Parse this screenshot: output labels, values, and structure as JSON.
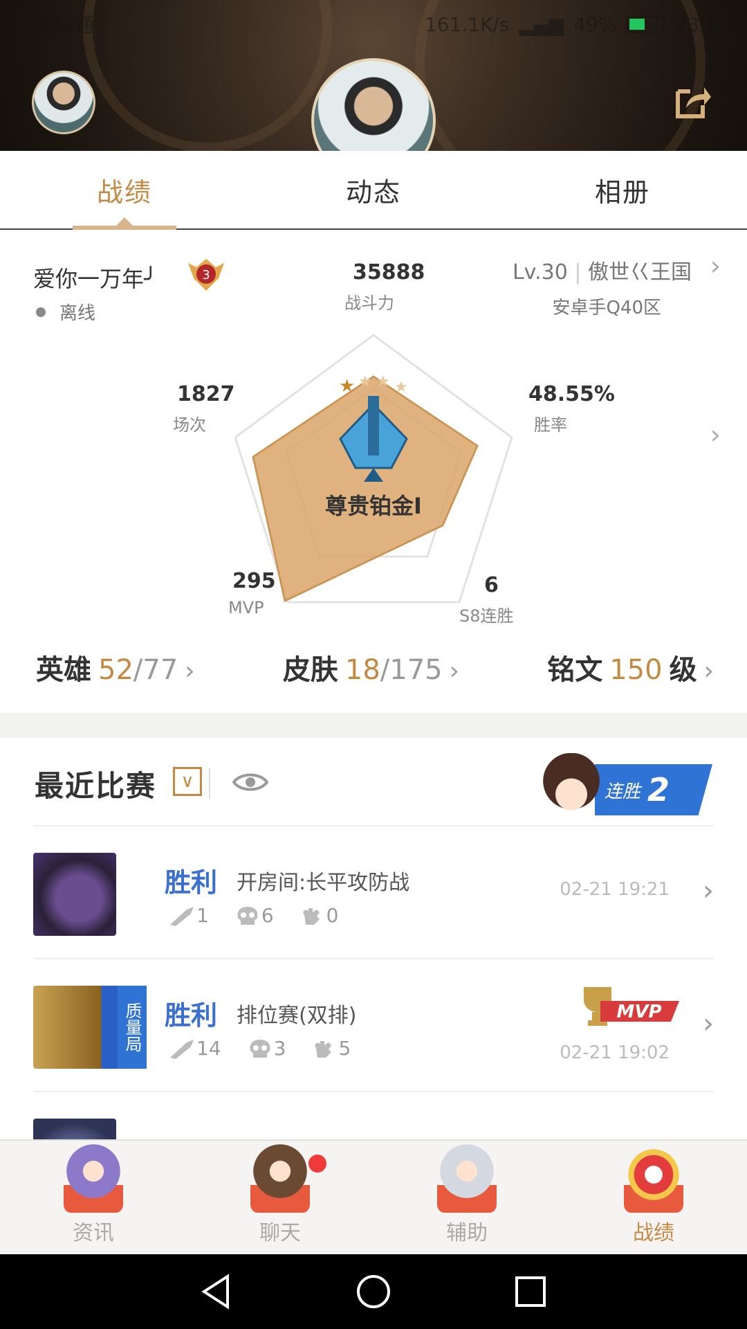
{
  "status_bar": {
    "carrier": "中国联通",
    "speed": "161.1K/s",
    "battery": "49%",
    "time": "23:51"
  },
  "tabs": [
    {
      "label": "战绩",
      "active": true
    },
    {
      "label": "动态",
      "active": false
    },
    {
      "label": "相册",
      "active": false
    }
  ],
  "profile": {
    "name": "爱你一万年╯",
    "rank_badge_number": "3",
    "status": "离线",
    "level": "Lv.30",
    "guild": "傲世巜王国",
    "server": "安卓手Q40区"
  },
  "radar": {
    "power_value": "35888",
    "power_label": "战斗力",
    "matches_value": "1827",
    "matches_label": "场次",
    "winrate_value": "48.55%",
    "winrate_label": "胜率",
    "mvp_value": "295",
    "mvp_label": "MVP",
    "streak_value": "6",
    "streak_label": "S8连胜",
    "rank_name": "尊贵铂金I",
    "stars_filled": 1,
    "stars_total": 4
  },
  "counts": {
    "heroes": {
      "label": "英雄",
      "owned": "52",
      "total": "77"
    },
    "skins": {
      "label": "皮肤",
      "owned": "18",
      "total": "175"
    },
    "inscription": {
      "label": "铭文",
      "value": "150",
      "unit": "级"
    }
  },
  "recent": {
    "title": "最近比赛",
    "streak_label": "连胜",
    "streak_count": "2",
    "matches": [
      {
        "result": "胜利",
        "mode": "开房间:长平攻防战",
        "kills": "1",
        "deaths": "6",
        "assists": "0",
        "time": "02-21 19:21",
        "quality": false,
        "mvp": false
      },
      {
        "result": "胜利",
        "mode": "排位赛(双排)",
        "kills": "14",
        "deaths": "3",
        "assists": "5",
        "time": "02-21 19:02",
        "quality": true,
        "quality_label": "质量局",
        "mvp": true,
        "mvp_label": "MVP"
      }
    ]
  },
  "bottom_nav": [
    {
      "label": "资讯",
      "active": false
    },
    {
      "label": "聊天",
      "active": false
    },
    {
      "label": "辅助",
      "active": false
    },
    {
      "label": "战绩",
      "active": true
    }
  ],
  "colors": {
    "accent": "#c48a44",
    "win_blue": "#3b6fd1",
    "radar_fill": "#d9a46a"
  }
}
